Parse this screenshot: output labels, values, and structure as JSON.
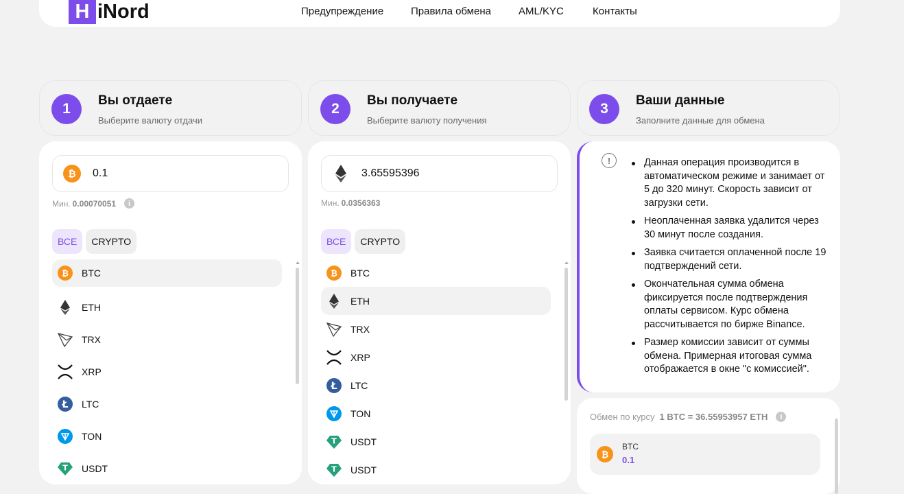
{
  "header": {
    "logo_letter": "H",
    "logo_text": "iNord",
    "nav": [
      "Предупреждение",
      "Правила обмена",
      "AML/KYC",
      "Контакты"
    ]
  },
  "steps": [
    {
      "num": "1",
      "title": "Вы отдаете",
      "subtitle": "Выберите валюту отдачи"
    },
    {
      "num": "2",
      "title": "Вы получаете",
      "subtitle": "Выберите валюту получения"
    },
    {
      "num": "3",
      "title": "Ваши данные",
      "subtitle": "Заполните данные для обмена"
    }
  ],
  "give": {
    "amount": "0.1",
    "currency_icon": "btc-icon",
    "min_label": "Мин.",
    "min_value": "0.00070051",
    "filters": [
      "ВСЕ",
      "CRYPTO"
    ],
    "active_filter": "ВСЕ",
    "coins": [
      "BTC",
      "ETH",
      "TRX",
      "XRP",
      "LTC",
      "TON",
      "USDT"
    ],
    "selected": "BTC"
  },
  "receive": {
    "amount": "3.65595396",
    "currency_icon": "eth-icon",
    "min_label": "Мин.",
    "min_value": "0.0356363",
    "filters": [
      "ВСЕ",
      "CRYPTO"
    ],
    "active_filter": "ВСЕ",
    "coins": [
      "BTC",
      "ETH",
      "TRX",
      "XRP",
      "LTC",
      "TON",
      "USDT",
      "USDT"
    ],
    "selected": "ETH"
  },
  "info": {
    "bullets": [
      "Данная операция производится в автоматическом режиме и занимает от 5 до 320 минут. Скорость зависит от загрузки сети.",
      "Неоплаченная заявка удалится через 30 минут после создания.",
      "Заявка считается оплаченной после 19 подтверждений сети.",
      "Окончательная сумма обмена фиксируется после подтверждения оплаты сервисом. Курс обмена рассчитывается по бирже Binance.",
      "Размер комиссии зависит от суммы обмена. Примерная итоговая сумма отображается в окне \"с комиссией\"."
    ]
  },
  "rate": {
    "label": "Обмен по курсу",
    "value": "1 BTC = 36.55953957 ETH",
    "give_currency": "BTC",
    "give_amount": "0.1"
  },
  "colors": {
    "accent": "#7c4dea",
    "btc": "#f7931a",
    "ltc": "#345d9d",
    "ton": "#0098ea",
    "usdt": "#26a17b"
  }
}
